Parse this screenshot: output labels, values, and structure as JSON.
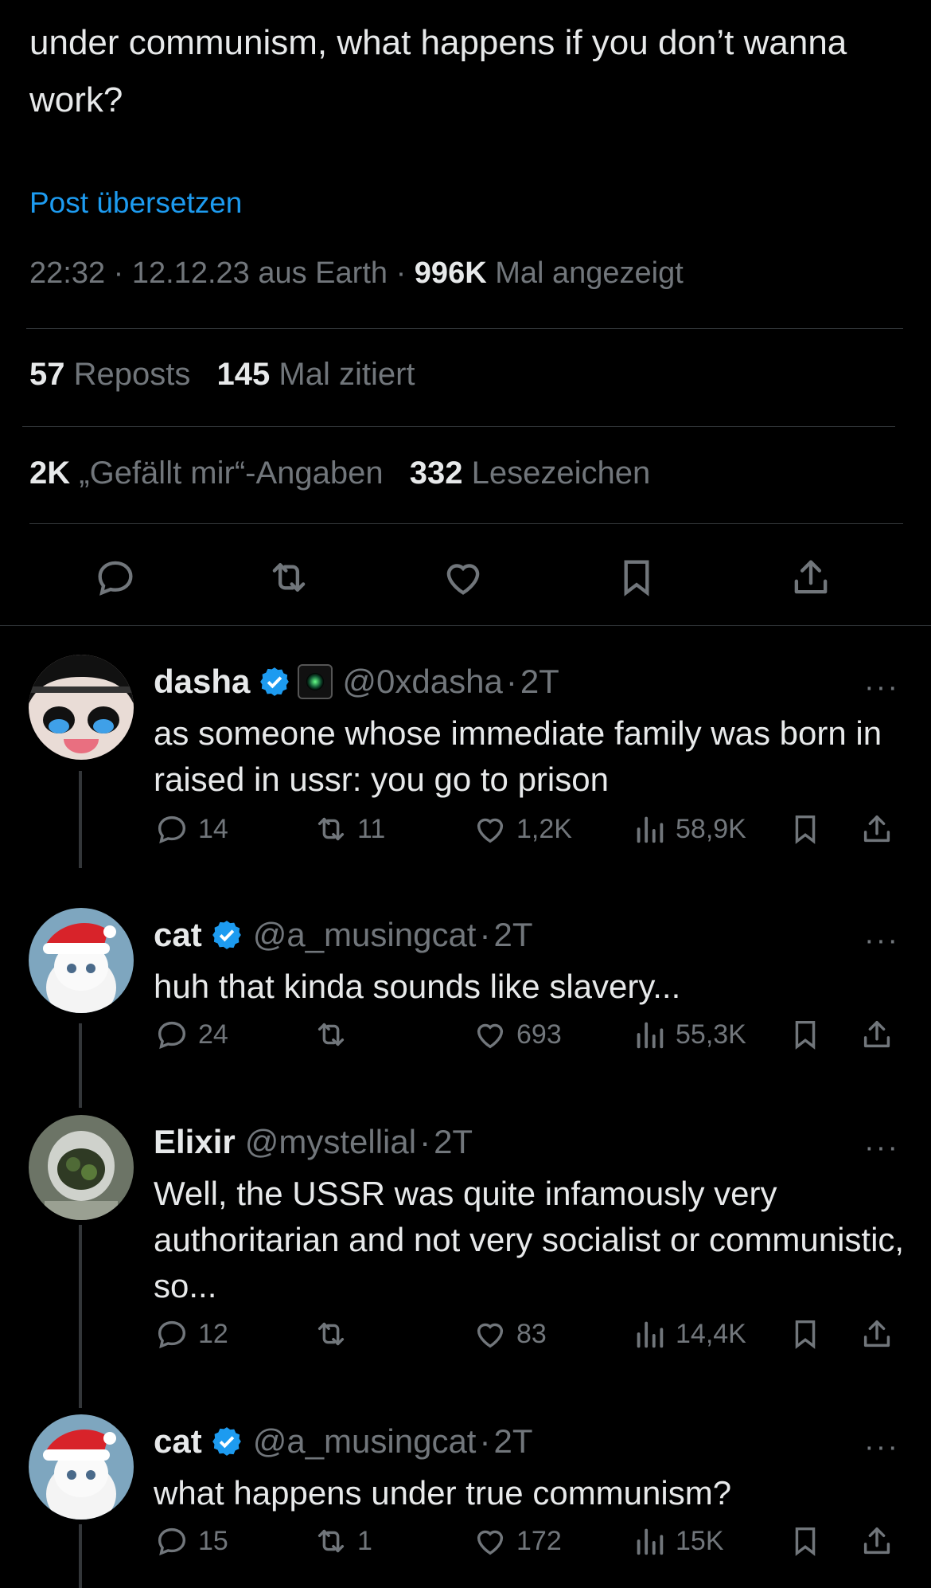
{
  "post": {
    "text": "under communism, what happens if you don’t wanna work?",
    "translate_label": "Post übersetzen",
    "time": "22:32",
    "date": "12.12.23",
    "location": "aus Earth",
    "views_count": "996K",
    "views_label": "Mal angezeigt",
    "reposts_count": "57",
    "reposts_label": "Reposts",
    "quotes_count": "145",
    "quotes_label": "Mal zitiert",
    "likes_count": "2K",
    "likes_label": "„Gefällt mir“-Angaben",
    "bookmarks_count": "332",
    "bookmarks_label": "Lesezeichen"
  },
  "colors": {
    "accent": "#1d9bf0",
    "muted": "#71767b",
    "text": "#e7e9ea",
    "background": "#000000"
  },
  "replies": [
    {
      "name": "dasha",
      "verified": true,
      "handle": "@0xdasha",
      "time": "2T",
      "text": "as someone whose immediate family was born in raised in ussr: you go to prison",
      "replies": "14",
      "reposts": "11",
      "likes": "1,2K",
      "views": "58,9K"
    },
    {
      "name": "cat",
      "verified": true,
      "handle": "@a_musingcat",
      "time": "2T",
      "text": "huh that kinda sounds like slavery...",
      "replies": "24",
      "reposts": "",
      "likes": "693",
      "views": "55,3K"
    },
    {
      "name": "Elixir",
      "verified": false,
      "handle": "@mystellial",
      "time": "2T",
      "text": "Well, the USSR was quite infamously very authoritarian and not very socialist or communistic, so...",
      "replies": "12",
      "reposts": "",
      "likes": "83",
      "views": "14,4K"
    },
    {
      "name": "cat",
      "verified": true,
      "handle": "@a_musingcat",
      "time": "2T",
      "text": "what happens under true communism?",
      "replies": "15",
      "reposts": "1",
      "likes": "172",
      "views": "15K"
    }
  ],
  "separator": "·",
  "more_glyph": "···"
}
